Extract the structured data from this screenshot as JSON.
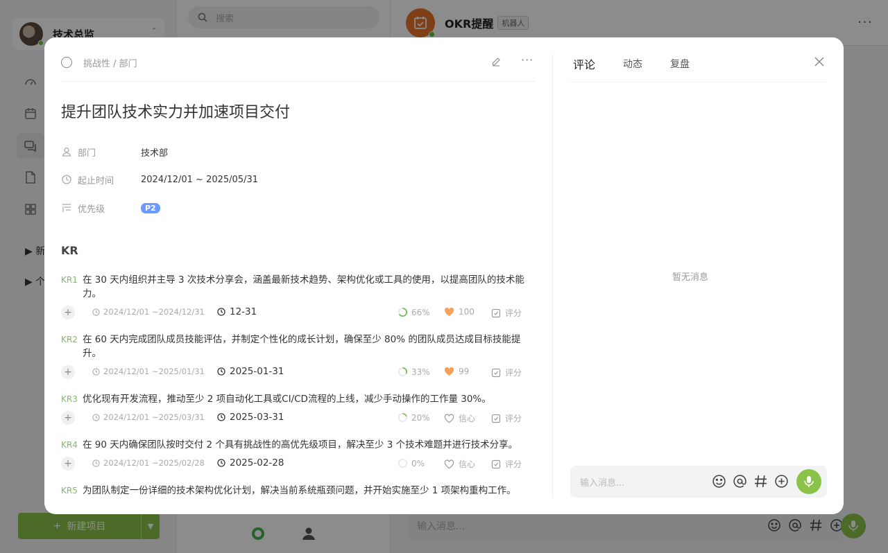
{
  "background": {
    "sidebar": {
      "username": "技术总监",
      "tree_items": [
        "新",
        "个"
      ],
      "new_project_label": "新建项目"
    },
    "list": {
      "search_placeholder": "搜索"
    },
    "chat": {
      "title": "OKR提醒",
      "bot_tag": "机器人",
      "input_placeholder": "输入消息..."
    }
  },
  "modal": {
    "breadcrumb": "挑战性 / 部门",
    "title": "提升团队技术实力并加速项目交付",
    "meta": {
      "department_label": "部门",
      "department_value": "技术部",
      "period_label": "起止时间",
      "period_value": "2024/12/01 ~ 2025/05/31",
      "priority_label": "优先级",
      "priority_value": "P2"
    },
    "kr_heading": "KR",
    "krs": [
      {
        "code": "KR1",
        "text": "在 30 天内组织并主导 3 次技术分享会，涵盖最新技术趋势、架构优化或工具的使用，以提高团队的技术能力。",
        "range": "2024/12/01 ~2024/12/31",
        "due": "12-31",
        "progress": 66,
        "progress_label": "66%",
        "confidence": "100",
        "confidence_filled": true,
        "score_label": "评分"
      },
      {
        "code": "KR2",
        "text": "在 60 天内完成团队成员技能评估，并制定个性化的成长计划，确保至少 80% 的团队成员达成目标技能提升。",
        "range": "2024/12/01 ~2025/01/31",
        "due": "2025-01-31",
        "progress": 33,
        "progress_label": "33%",
        "confidence": "99",
        "confidence_filled": true,
        "score_label": "评分"
      },
      {
        "code": "KR3",
        "text": "优化现有开发流程，推动至少 2 项自动化工具或CI/CD流程的上线，减少手动操作的工作量 30%。",
        "range": "2024/12/01 ~2025/03/31",
        "due": "2025-03-31",
        "progress": 20,
        "progress_label": "20%",
        "confidence": "信心",
        "confidence_filled": false,
        "score_label": "评分"
      },
      {
        "code": "KR4",
        "text": "在 90 天内确保团队按时交付 2 个具有挑战性的高优先级项目，解决至少 3 个技术难题并进行技术分享。",
        "range": "2024/12/01 ~2025/02/28",
        "due": "2025-02-28",
        "progress": 0,
        "progress_label": "0%",
        "confidence": "信心",
        "confidence_filled": false,
        "score_label": "评分"
      },
      {
        "code": "KR5",
        "text": "为团队制定一份详细的技术架构优化计划，解决当前系统瓶颈问题，并开始实施至少 1 项架构重构工作。"
      }
    ],
    "tabs": [
      "评论",
      "动态",
      "复盘"
    ],
    "empty_message": "暂无消息",
    "input_placeholder": "输入消息..."
  },
  "colors": {
    "accent_green": "#8bc34a",
    "kr_code": "#7cbf5f",
    "priority_badge": "#6b9bff",
    "confidence_heart": "#f4a259"
  }
}
